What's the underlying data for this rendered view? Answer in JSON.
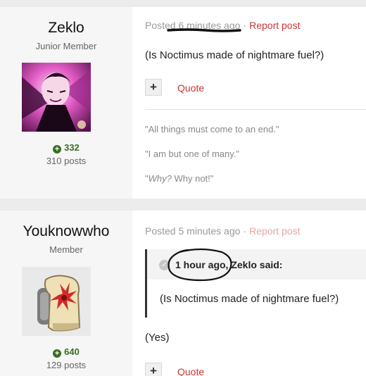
{
  "posts": [
    {
      "author": "Zeklo",
      "rank": "Junior Member",
      "reputation": "332",
      "post_count": "310 posts",
      "meta_posted": "Posted 6 minutes ago",
      "report_label": "Report post",
      "body": "(Is Noctimus made of nightmare fuel?)",
      "add_label": "+",
      "quote_label": "Quote",
      "signature": {
        "line1": "\"All things must come to an end.\"",
        "line2": "\"I am but one of many.\"",
        "line3_italic": "Why?",
        "line3_rest": " Why not!\"",
        "line3_open": "\""
      }
    },
    {
      "author": "Youknowwho",
      "rank": "Member",
      "reputation": "640",
      "post_count": "129 posts",
      "meta_posted": "Posted 5 minutes ago",
      "report_label": "Report post",
      "quote_header": "1 hour ago, Zeklo said:",
      "quote_body": "(Is Noctimus made of nightmare fuel?)",
      "reply": "(Yes)",
      "add_label": "+",
      "quote_label": "Quote"
    }
  ],
  "meta_separator": "·",
  "colors": {
    "accent_red": "#cc3333",
    "rep_green": "#3b6e22",
    "sidebar_bg": "#f6f6f6"
  },
  "icons": {
    "rep": "plus-circle-icon",
    "quote_check": "check-circle-icon"
  }
}
